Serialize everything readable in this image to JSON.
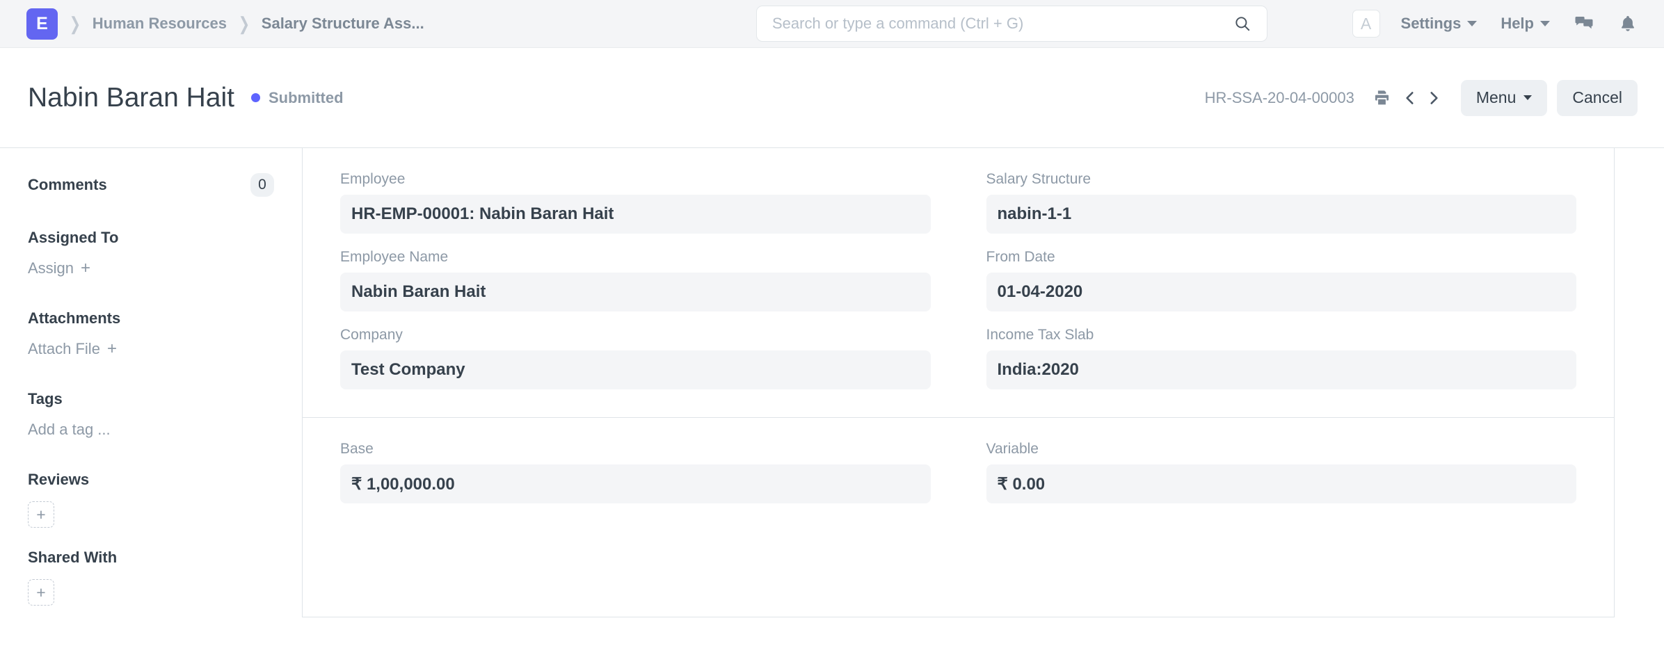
{
  "navbar": {
    "logo_letter": "E",
    "breadcrumbs": [
      {
        "label": "Human Resources"
      },
      {
        "label": "Salary Structure Ass..."
      }
    ],
    "search": {
      "value": "",
      "placeholder": "Search or type a command (Ctrl + G)",
      "icon": "search-icon"
    },
    "avatar_letter": "A",
    "links": [
      {
        "label": "Settings"
      },
      {
        "label": "Help"
      }
    ],
    "icons": [
      {
        "name": "chat-icon"
      },
      {
        "name": "notification-bell-icon"
      }
    ]
  },
  "page_head": {
    "title": "Nabin Baran Hait",
    "status": "Submitted",
    "status_color": "#5e64ff",
    "doc_id": "HR-SSA-20-04-00003",
    "print_icon": "print-icon",
    "prev_icon": "chevron-left-icon",
    "next_icon": "chevron-right-icon",
    "menu_label": "Menu",
    "cancel_label": "Cancel"
  },
  "sidebar": {
    "comments": {
      "label": "Comments",
      "count": "0"
    },
    "assigned_to": {
      "label": "Assigned To",
      "action": "Assign"
    },
    "attachments": {
      "label": "Attachments",
      "action": "Attach File"
    },
    "tags": {
      "label": "Tags",
      "action": "Add a tag ..."
    },
    "reviews": {
      "label": "Reviews",
      "add": "+"
    },
    "shared_with": {
      "label": "Shared With",
      "add": "+"
    }
  },
  "form": {
    "sections": [
      {
        "left": [
          {
            "label": "Employee",
            "value": "HR-EMP-00001: Nabin Baran Hait"
          },
          {
            "label": "Employee Name",
            "value": "Nabin Baran Hait"
          },
          {
            "label": "Company",
            "value": "Test Company"
          }
        ],
        "right": [
          {
            "label": "Salary Structure",
            "value": "nabin-1-1"
          },
          {
            "label": "From Date",
            "value": "01-04-2020"
          },
          {
            "label": "Income Tax Slab",
            "value": "India:2020"
          }
        ]
      },
      {
        "left": [
          {
            "label": "Base",
            "value": "₹ 1,00,000.00"
          }
        ],
        "right": [
          {
            "label": "Variable",
            "value": "₹ 0.00"
          }
        ]
      }
    ]
  }
}
